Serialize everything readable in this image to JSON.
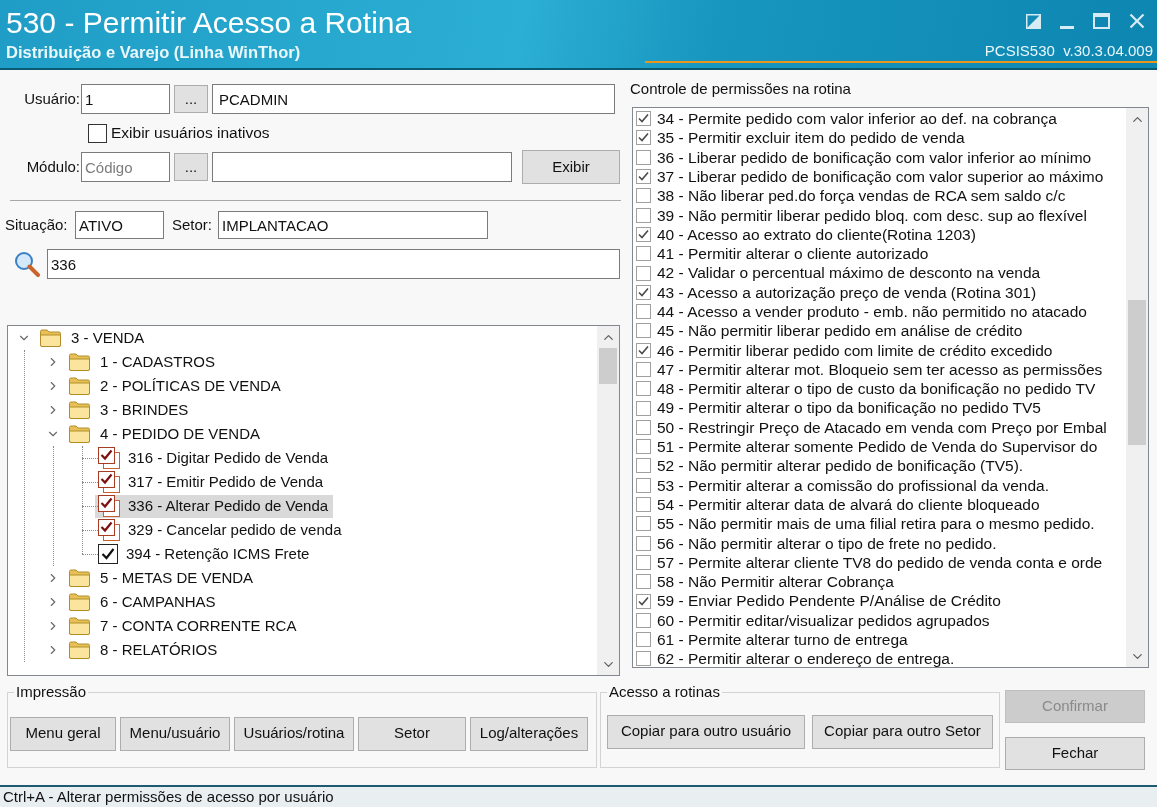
{
  "window": {
    "title": "530 - Permitir Acesso a Rotina",
    "subtitle": "Distribuição e Varejo (Linha WinThor)",
    "version": "PCSIS530  v.30.3.04.009"
  },
  "user": {
    "label": "Usuário:",
    "code": "1",
    "lookup": "...",
    "name": "PCADMIN"
  },
  "show_inactive": {
    "label": "Exibir usuários inativos",
    "checked": false
  },
  "module": {
    "label": "Módulo:",
    "placeholder": "Código",
    "lookup": "...",
    "show_button": "Exibir"
  },
  "info": {
    "situation_label": "Situação:",
    "situation": "ATIVO",
    "sector_label": "Setor:",
    "sector": "IMPLANTACAO"
  },
  "search": {
    "value": "336"
  },
  "tree": [
    {
      "kind": "folder",
      "label": "3 - VENDA",
      "expanded": true,
      "selected": false,
      "children": [
        {
          "kind": "folder",
          "label": "1 - CADASTROS",
          "expanded": false,
          "selected": false
        },
        {
          "kind": "folder",
          "label": "2 - POLÍTICAS DE VENDA",
          "expanded": false,
          "selected": false
        },
        {
          "kind": "folder",
          "label": "3 - BRINDES",
          "expanded": false,
          "selected": false
        },
        {
          "kind": "folder",
          "label": "4 - PEDIDO DE VENDA",
          "expanded": true,
          "selected": false,
          "children": [
            {
              "kind": "stacked",
              "label": "316 - Digitar Pedido de Venda",
              "checked": true,
              "selected": false
            },
            {
              "kind": "stacked",
              "label": "317 - Emitir Pedido de Venda",
              "checked": true,
              "selected": false
            },
            {
              "kind": "stacked",
              "label": "336 - Alterar Pedido de Venda",
              "checked": true,
              "selected": true
            },
            {
              "kind": "stacked",
              "label": "329 - Cancelar pedido de venda",
              "checked": true,
              "selected": false
            },
            {
              "kind": "single",
              "label": "394 - Retenção ICMS Frete",
              "checked": true,
              "selected": false
            }
          ]
        },
        {
          "kind": "folder",
          "label": "5 - METAS DE VENDA",
          "expanded": false,
          "selected": false
        },
        {
          "kind": "folder",
          "label": "6 - CAMPANHAS",
          "expanded": false,
          "selected": false
        },
        {
          "kind": "folder",
          "label": "7 - CONTA CORRENTE RCA",
          "expanded": false,
          "selected": false
        },
        {
          "kind": "folder",
          "label": "8 - RELATÓRIOS",
          "expanded": false,
          "selected": false
        }
      ]
    }
  ],
  "permissions": {
    "title": "Controle de permissões na rotina",
    "items": [
      {
        "label": "34 - Permite pedido com valor inferior ao def. na cobrança",
        "checked": true
      },
      {
        "label": "35 - Permitir excluir item do pedido de venda",
        "checked": true
      },
      {
        "label": "36 - Liberar pedido de bonificação com valor inferior ao mínimo",
        "checked": false
      },
      {
        "label": "37 - Liberar pedido de bonificação com valor superior ao máximo",
        "checked": true
      },
      {
        "label": "38 - Não liberar ped.do força vendas de RCA sem saldo c/c",
        "checked": false
      },
      {
        "label": "39 - Não permitir liberar pedido bloq. com desc. sup ao flexível",
        "checked": false
      },
      {
        "label": "40 - Acesso ao extrato do cliente(Rotina 1203)",
        "checked": true
      },
      {
        "label": "41 - Permitir alterar o cliente autorizado",
        "checked": false
      },
      {
        "label": "42 - Validar o percentual máximo de desconto na venda",
        "checked": false
      },
      {
        "label": "43 - Acesso a autorização preço de venda (Rotina 301)",
        "checked": true
      },
      {
        "label": "44 - Acesso a vender produto - emb. não permitido no atacado",
        "checked": false
      },
      {
        "label": "45 - Não permitir liberar pedido em análise de crédito",
        "checked": false
      },
      {
        "label": "46 - Permitir liberar pedido com limite de crédito excedido",
        "checked": true
      },
      {
        "label": "47 - Permitir alterar mot. Bloqueio sem ter acesso as permissões",
        "checked": false
      },
      {
        "label": "48 - Permitir alterar o tipo de custo da bonificação no pedido TV",
        "checked": false
      },
      {
        "label": "49 - Permitir alterar o tipo da bonificação no pedido TV5",
        "checked": false
      },
      {
        "label": "50 - Restringir Preço de Atacado em venda com Preço por Embal",
        "checked": false
      },
      {
        "label": "51 - Permite alterar somente Pedido de Venda do Supervisor do",
        "checked": false
      },
      {
        "label": "52 - Não permitir alterar pedido de bonificação (TV5).",
        "checked": false
      },
      {
        "label": "53 - Permitir alterar a comissão do profissional da venda.",
        "checked": false
      },
      {
        "label": "54 - Permitir alterar data de alvará do cliente bloqueado",
        "checked": false
      },
      {
        "label": "55 - Não permitir mais de uma filial retira para o mesmo pedido.",
        "checked": false
      },
      {
        "label": "56 - Não permitir alterar o tipo de frete no pedido.",
        "checked": false
      },
      {
        "label": "57 - Permite alterar cliente TV8 do pedido de venda conta e orde",
        "checked": false
      },
      {
        "label": "58 - Não Permitir alterar Cobrança",
        "checked": false
      },
      {
        "label": "59 - Enviar Pedido Pendente P/Análise de Crédito",
        "checked": true
      },
      {
        "label": "60 - Permitir editar/visualizar pedidos agrupados",
        "checked": false
      },
      {
        "label": "61 - Permite alterar turno de entrega",
        "checked": false
      },
      {
        "label": "62 - Permitir alterar o endereço de entrega.",
        "checked": false
      }
    ]
  },
  "print_group": {
    "title": "Impressão",
    "buttons": [
      "Menu geral",
      "Menu/usuário",
      "Usuários/rotina",
      "Setor",
      "Log/alterações"
    ]
  },
  "access_group": {
    "title": "Acesso a rotinas",
    "buttons": [
      "Copiar para outro usuário",
      "Copiar para outro Setor"
    ]
  },
  "actions": [
    {
      "label": "Confirmar",
      "disabled": true
    },
    {
      "label": "Fechar",
      "disabled": false
    }
  ],
  "status_bar": "Ctrl+A - Alterar permissões de acesso por usuário"
}
